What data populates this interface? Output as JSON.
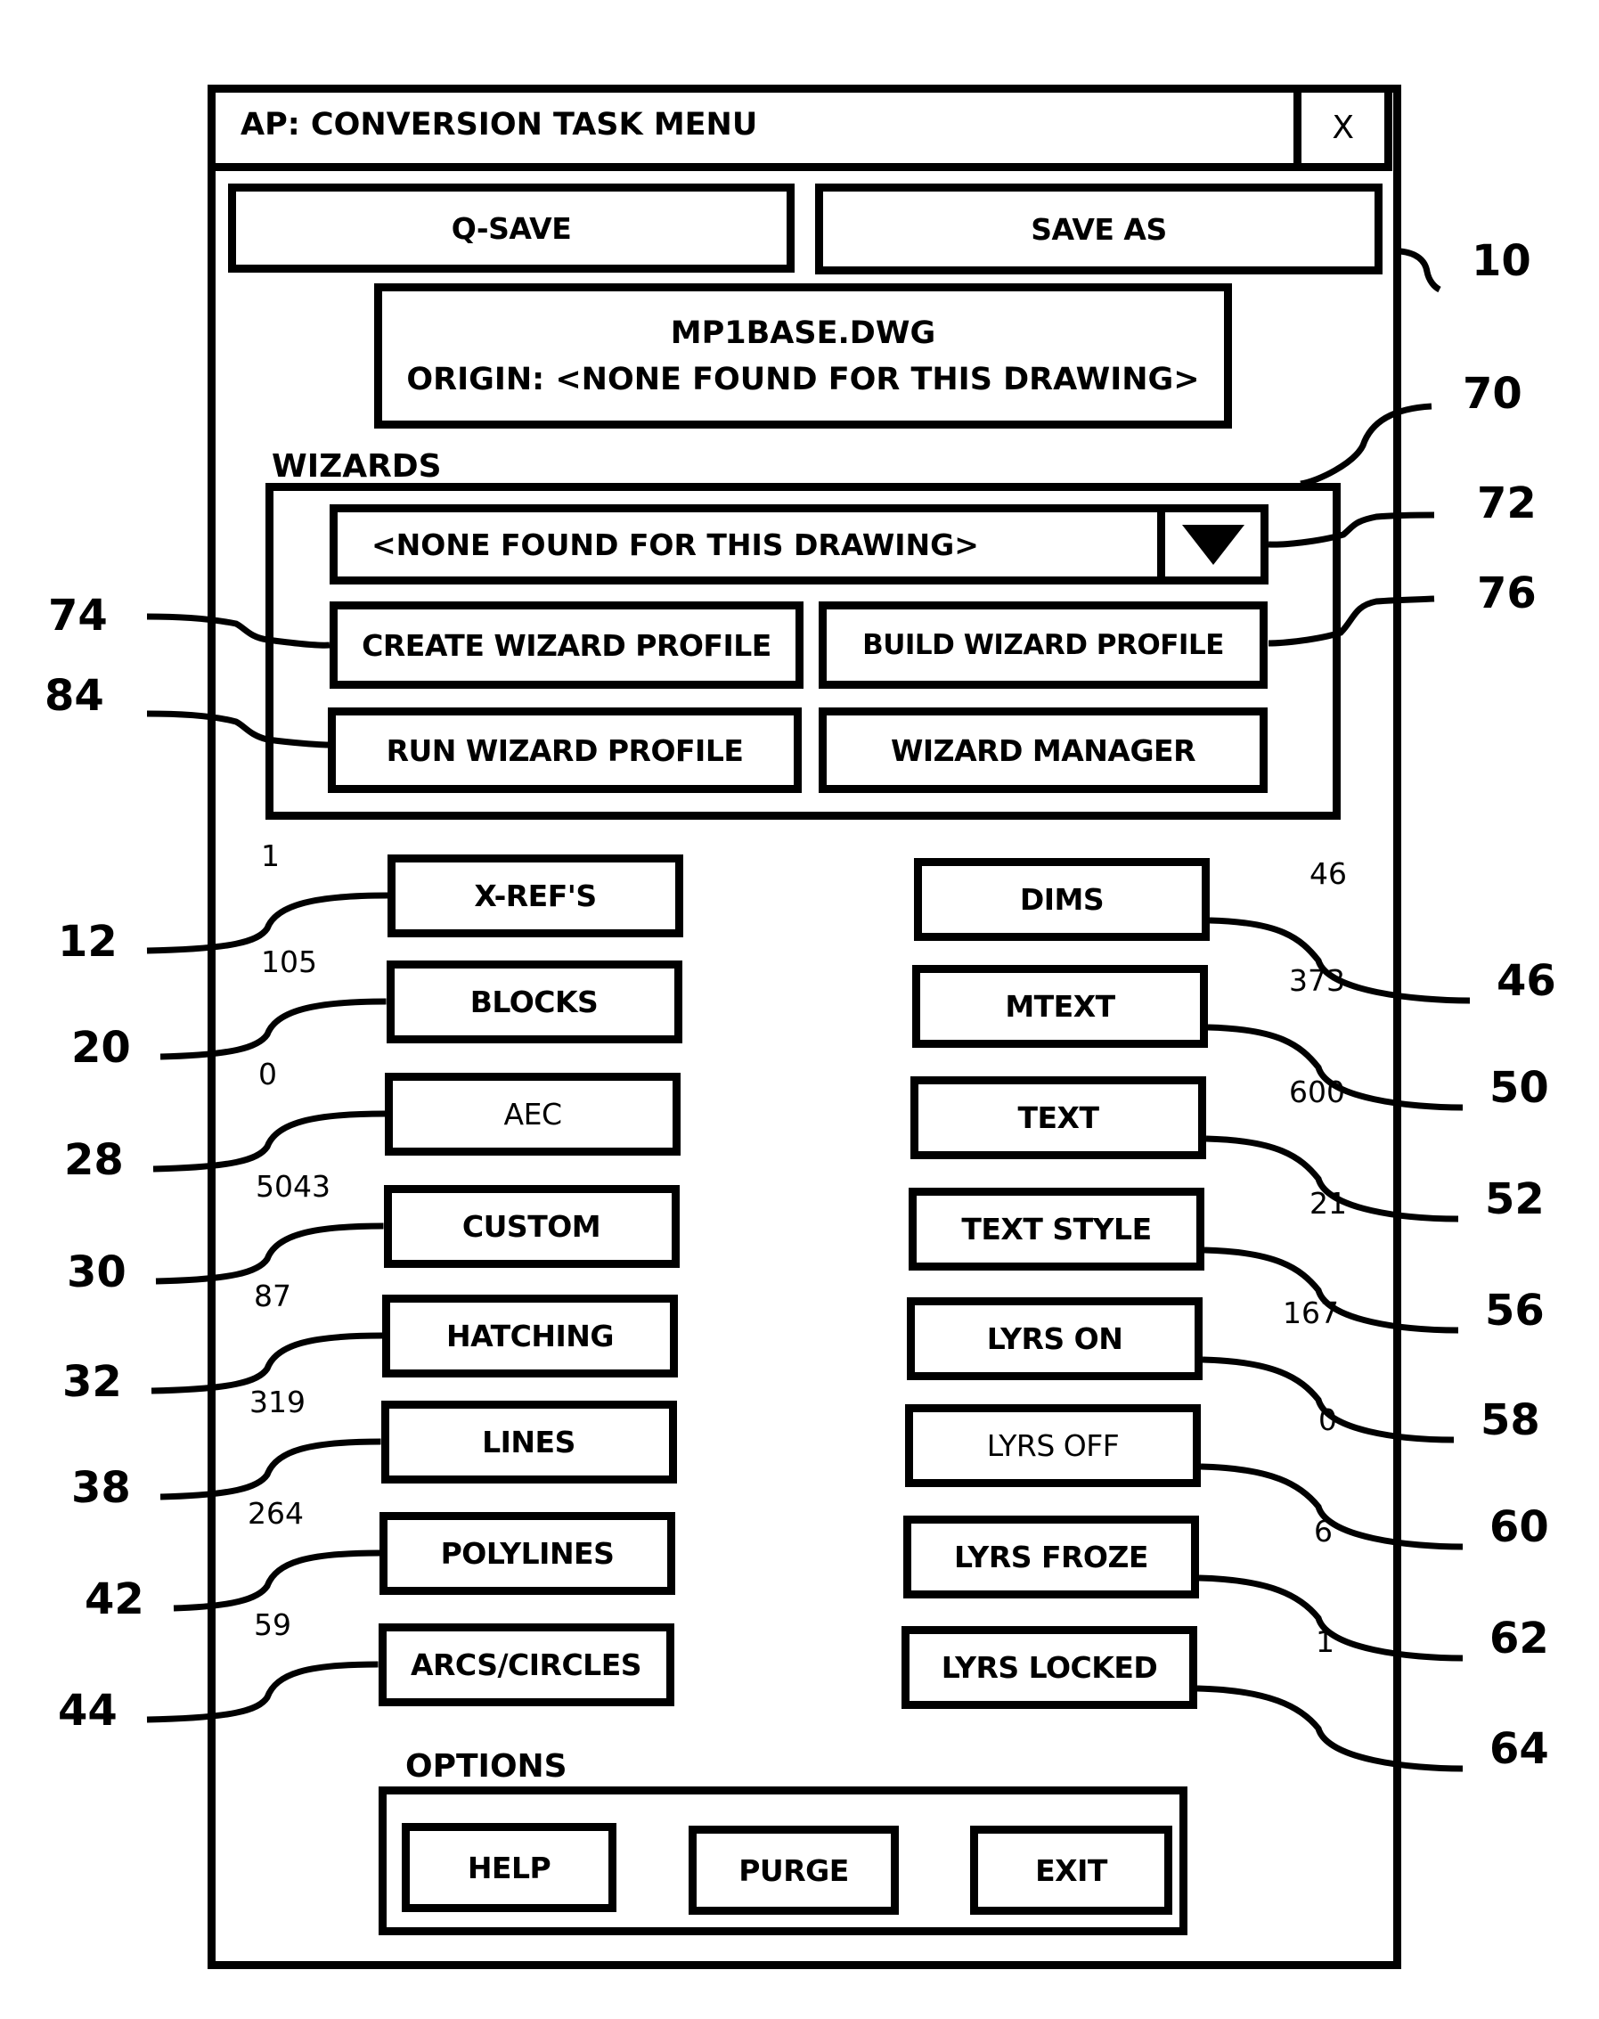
{
  "window": {
    "title": "AP: CONVERSION TASK MENU",
    "close_label": "X"
  },
  "top_buttons": {
    "qsave": "Q-SAVE",
    "save_as": "SAVE AS"
  },
  "file_info": {
    "filename": "MP1BASE.DWG",
    "origin": "ORIGIN: <NONE FOUND FOR THIS DRAWING>"
  },
  "wizards": {
    "label": "WIZARDS",
    "dropdown": {
      "selected": "<NONE FOUND FOR THIS DRAWING>",
      "arrow_icon": "triangle-down"
    },
    "buttons": {
      "create": "CREATE WIZARD PROFILE",
      "build": "BUILD WIZARD PROFILE",
      "run": "RUN WIZARD PROFILE",
      "manager": "WIZARD MANAGER"
    }
  },
  "left_items": [
    {
      "label": "X-REF'S",
      "count": "1",
      "ref": "12",
      "enabled": true
    },
    {
      "label": "BLOCKS",
      "count": "105",
      "ref": "20",
      "enabled": true
    },
    {
      "label": "AEC",
      "count": "0",
      "ref": "28",
      "enabled": false
    },
    {
      "label": "CUSTOM",
      "count": "5043",
      "ref": "30",
      "enabled": true
    },
    {
      "label": "HATCHING",
      "count": "87",
      "ref": "32",
      "enabled": true
    },
    {
      "label": "LINES",
      "count": "319",
      "ref": "38",
      "enabled": true
    },
    {
      "label": "POLYLINES",
      "count": "264",
      "ref": "42",
      "enabled": true
    },
    {
      "label": "ARCS/CIRCLES",
      "count": "59",
      "ref": "44",
      "enabled": true
    }
  ],
  "right_items": [
    {
      "label": "DIMS",
      "count": "46",
      "ref": "46",
      "enabled": true
    },
    {
      "label": "MTEXT",
      "count": "373",
      "ref": "50",
      "enabled": true
    },
    {
      "label": "TEXT",
      "count": "600",
      "ref": "52",
      "enabled": true
    },
    {
      "label": "TEXT STYLE",
      "count": "21",
      "ref": "56",
      "enabled": true
    },
    {
      "label": "LYRS ON",
      "count": "167",
      "ref": "58",
      "enabled": true
    },
    {
      "label": "LYRS OFF",
      "count": "0",
      "ref": "60",
      "enabled": false
    },
    {
      "label": "LYRS FROZE",
      "count": "6",
      "ref": "62",
      "enabled": true
    },
    {
      "label": "LYRS LOCKED",
      "count": "1",
      "ref": "64",
      "enabled": true
    }
  ],
  "options": {
    "label": "OPTIONS",
    "help": "HELP",
    "purge": "PURGE",
    "exit": "EXIT"
  },
  "reference_numerals": {
    "dialog": "10",
    "wizards_box": "70",
    "dropdown": "72",
    "create": "74",
    "build": "76",
    "run": "84"
  }
}
